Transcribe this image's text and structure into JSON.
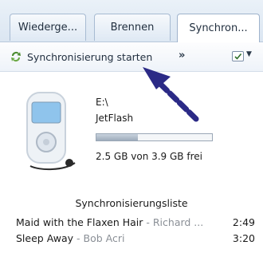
{
  "tabs": [
    {
      "label": "Wiederge..."
    },
    {
      "label": "Brennen"
    },
    {
      "label": "Synchron..."
    }
  ],
  "toolbar": {
    "sync_label": "Synchronisierung starten",
    "more_label": "»"
  },
  "device": {
    "drive": "E:\\",
    "name": "JetFlash",
    "used_fraction": 0.36,
    "space": "2.5 GB von 3.9 GB frei"
  },
  "sync_list": {
    "title": "Synchronisierungsliste",
    "items": [
      {
        "title": "Maid with the Flaxen Hair",
        "artist": " - Richard ...",
        "duration": "2:49"
      },
      {
        "title": "Sleep Away",
        "artist": " - Bob Acri",
        "duration": "3:20"
      }
    ]
  },
  "colors": {
    "annotation_arrow": "#2b2a86",
    "accent": "#3a7a2a"
  }
}
